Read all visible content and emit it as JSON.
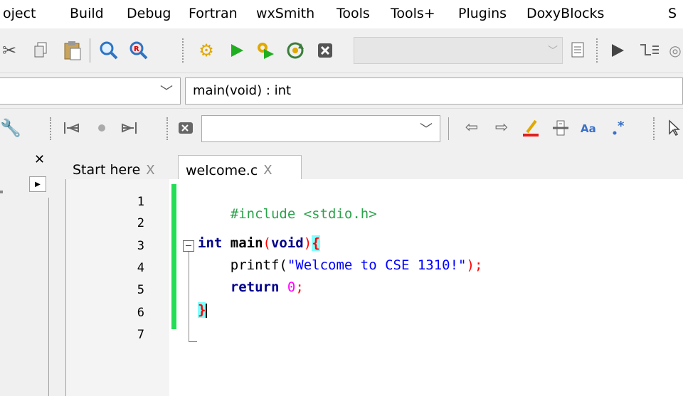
{
  "menubar": {
    "items": [
      "oject",
      "Build",
      "Debug",
      "Fortran",
      "wxSmith",
      "Tools",
      "Tools+",
      "Plugins",
      "DoxyBlocks",
      "S"
    ]
  },
  "toolbar2": {
    "function_combo": "main(void) : int"
  },
  "tabs": [
    {
      "label": "Start here",
      "close": "X"
    },
    {
      "label": "welcome.c",
      "close": "X"
    }
  ],
  "editor": {
    "line_numbers": [
      "1",
      "2",
      "3",
      "4",
      "5",
      "6",
      "7"
    ],
    "lines": {
      "l1": {
        "directive": "#include <stdio.h>"
      },
      "l3": {
        "keyword": "int",
        "name": " main",
        "lparen": "(",
        "param": "void",
        "rparen": ")",
        "brace": "{"
      },
      "l4": {
        "indent": "    ",
        "call": "printf(",
        "string": "\"Welcome to CSE 1310!\"",
        "end": ");"
      },
      "l5": {
        "indent": "    ",
        "keyword": "return",
        "space": " ",
        "number": "0",
        "semi": ";"
      },
      "l6": {
        "brace": "}"
      }
    }
  },
  "colors": {
    "directive": "#2aa34a",
    "keyword": "#00008b",
    "string": "#0000ff",
    "number": "#ff00ff",
    "operator": "#ff0000",
    "brace_highlight": "#80ffff",
    "changebar": "#22dd55"
  },
  "icons": {
    "toolbar1": [
      "scissors-icon",
      "copy-icon",
      "paste-icon",
      "find-icon",
      "replace-icon",
      "build-gear-icon",
      "run-icon",
      "build-run-icon",
      "rebuild-icon",
      "abort-icon",
      "build-target-icon",
      "debug-run-icon",
      "debug-step-icon"
    ],
    "toolbar3": [
      "wrench-icon",
      "prev-bookmark-icon",
      "toggle-bookmark-icon",
      "next-bookmark-icon",
      "clear-icon",
      "back-icon",
      "forward-icon",
      "highlight-icon",
      "match-icon",
      "match-case-icon",
      "regex-icon",
      "select-icon"
    ]
  }
}
